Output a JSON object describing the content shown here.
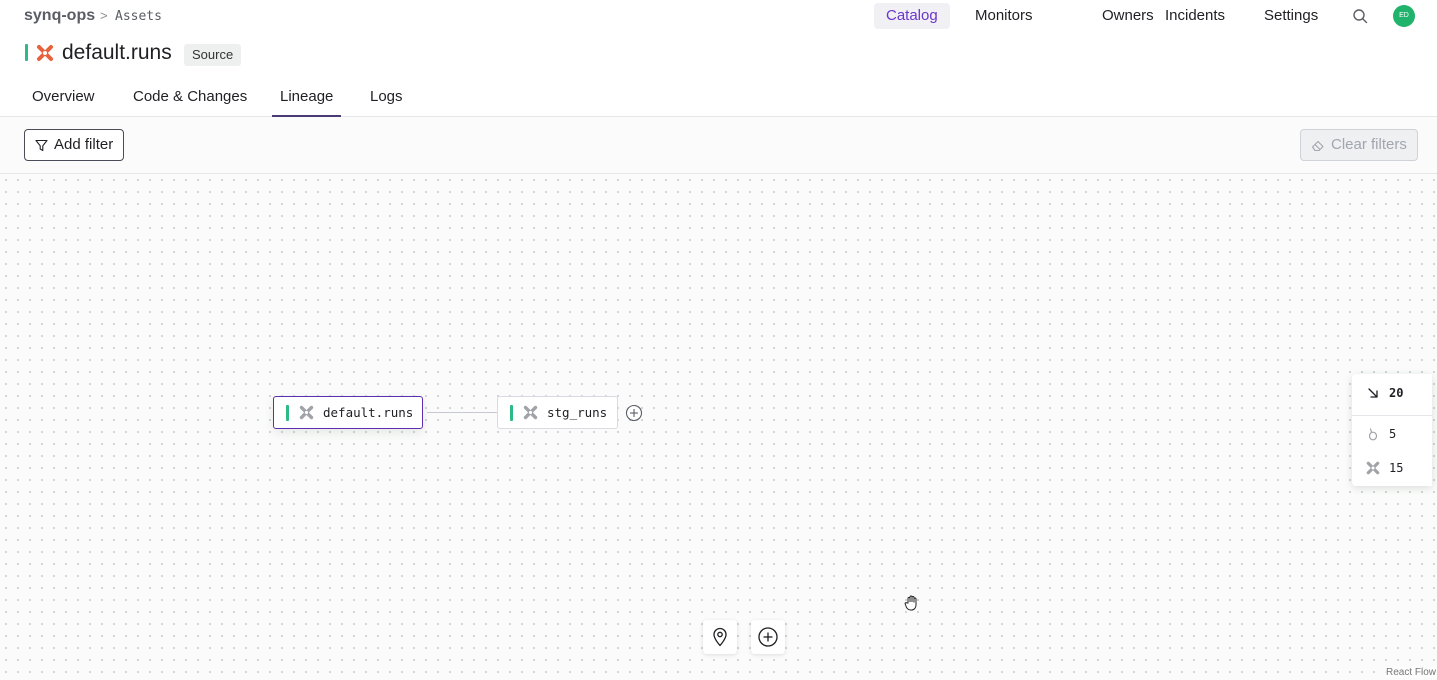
{
  "header": {
    "brand": "synq-ops",
    "breadcrumb_sep": ">",
    "breadcrumb": "Assets",
    "nav": [
      {
        "label": "Catalog",
        "active": true
      },
      {
        "label": "Monitors"
      },
      {
        "label": "Owners"
      },
      {
        "label": "Incidents"
      },
      {
        "label": "Settings"
      }
    ],
    "search_icon": "search-icon",
    "avatar_initials": "ED",
    "avatar_color": "#1fb36b"
  },
  "asset": {
    "title": "default.runs",
    "badge": "Source",
    "icon": "clickhouse-x-icon",
    "status_color": "#2dba85"
  },
  "tabs": [
    {
      "label": "Overview"
    },
    {
      "label": "Code & Changes"
    },
    {
      "label": "Lineage",
      "active": true
    },
    {
      "label": "Logs"
    }
  ],
  "filters": {
    "add_label": "Add filter",
    "clear_label": "Clear filters"
  },
  "lineage": {
    "nodes": [
      {
        "label": "default.runs",
        "selected": true
      },
      {
        "label": "stg_runs"
      }
    ]
  },
  "stats": {
    "total": "20",
    "sources": "5",
    "models": "15"
  },
  "controls": {
    "locate_icon": "map-pin-icon",
    "add_icon": "plus-circle-icon"
  },
  "attribution": "React Flow"
}
